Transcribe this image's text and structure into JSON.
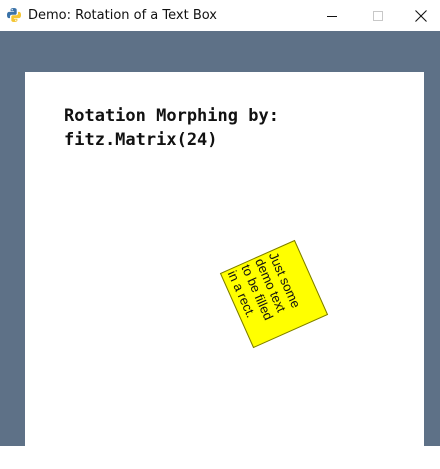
{
  "window": {
    "title": "Demo: Rotation of a Text Box",
    "app_icon": "python-icon",
    "controls": [
      "minimize-icon",
      "maximize-icon",
      "close-icon"
    ]
  },
  "canvas": {
    "heading_line1": "Rotation Morphing by:",
    "heading_line2": "fitz.Matrix(24)",
    "textbox": {
      "line1": "Just some",
      "line2": "demo text",
      "line3": "to be filled",
      "line4": "in a rect.",
      "fill_color": "#ffff00",
      "rotation_degrees": 24
    }
  },
  "colors": {
    "frame": "#5e7187",
    "page": "#ffffff",
    "textbox": "#ffff00"
  }
}
